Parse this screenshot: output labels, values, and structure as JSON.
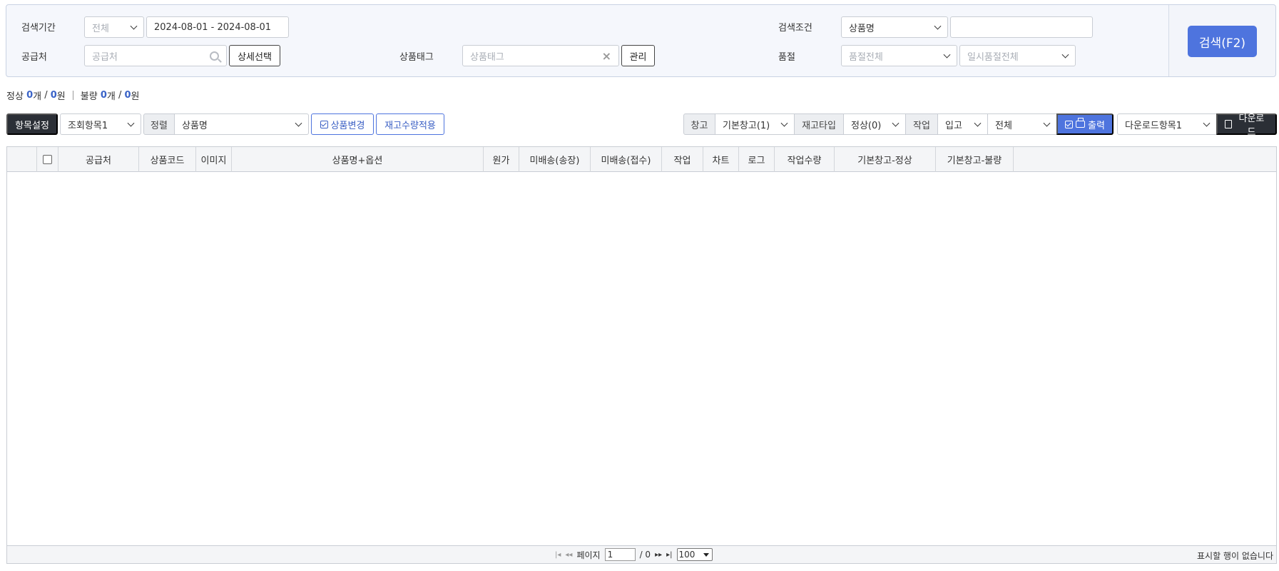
{
  "search": {
    "period_label": "검색기간",
    "period_type": "전체",
    "date_range": "2024-08-01 - 2024-08-01",
    "supplier_label": "공급처",
    "supplier_placeholder": "공급처",
    "detail_select_label": "상세선택",
    "product_tag_label": "상품태그",
    "product_tag_placeholder": "상품태그",
    "manage_label": "관리",
    "condition_label": "검색조건",
    "condition_value": "상품명",
    "condition_text": "",
    "soldout_label": "품절",
    "soldout_value": "품절전체",
    "temp_soldout_value": "일시품절전체",
    "search_button": "검색(F2)"
  },
  "summary": {
    "normal_label": "정상",
    "normal_count": "0",
    "normal_amount": "0",
    "defect_label": "불량",
    "defect_count": "0",
    "defect_amount": "0",
    "unit_count": "개",
    "unit_won": "원",
    "slash": " / "
  },
  "toolbar": {
    "column_settings": "항목설정",
    "view_items": "조회항목1",
    "sort_label": "정렬",
    "sort_value": "상품명",
    "product_change": "상품변경",
    "apply_stock": "재고수량적용",
    "warehouse_label": "창고",
    "warehouse_value": "기본창고(1)",
    "stock_type_label": "재고타입",
    "stock_type_value": "정상(0)",
    "work_label": "작업",
    "work_value": "입고",
    "scope_value": "전체",
    "print_label": "출력",
    "download_items": "다운로드항목1",
    "download_label": "다운로드"
  },
  "grid": {
    "columns": [
      "공급처",
      "상품코드",
      "이미지",
      "상품명+옵션",
      "원가",
      "미배송(송장)",
      "미배송(접수)",
      "작업",
      "차트",
      "로그",
      "작업수량",
      "기본창고-정상",
      "기본창고-불량"
    ],
    "rows": [],
    "empty_message": "표시할 행이 없습니다"
  },
  "pager": {
    "page_label": "페이지",
    "current_page": "1",
    "total_pages": "/ 0",
    "page_size": "100"
  },
  "colors": {
    "accent": "#4e74de",
    "dark_button": "#2b2f36",
    "panel_bg": "#f5f7fc"
  }
}
